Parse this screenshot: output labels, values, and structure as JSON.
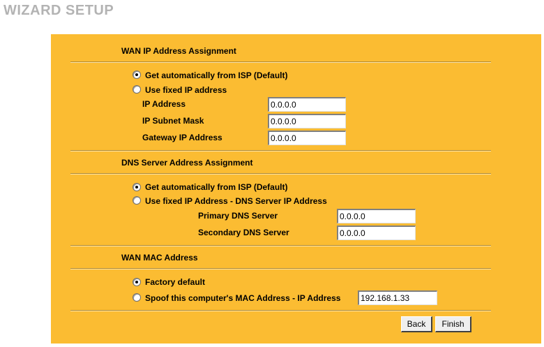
{
  "page_title": "WIZARD SETUP",
  "wan_ip": {
    "title": "WAN IP Address Assignment",
    "option_auto": "Get automatically from ISP (Default)",
    "option_fixed": "Use fixed IP address",
    "selected": "auto",
    "ip_address_label": "IP Address",
    "ip_address_value": "0.0.0.0",
    "subnet_mask_label": "IP Subnet Mask",
    "subnet_mask_value": "0.0.0.0",
    "gateway_label": "Gateway IP Address",
    "gateway_value": "0.0.0.0"
  },
  "dns": {
    "title": "DNS Server Address Assignment",
    "option_auto": "Get automatically from ISP (Default)",
    "option_fixed": "Use fixed IP Address - DNS Server IP Address",
    "selected": "auto",
    "primary_label": "Primary DNS Server",
    "primary_value": "0.0.0.0",
    "secondary_label": "Secondary DNS Server",
    "secondary_value": "0.0.0.0"
  },
  "wan_mac": {
    "title": "WAN MAC Address",
    "option_factory": "Factory default",
    "option_spoof": "Spoof this computer's MAC Address - IP Address",
    "selected": "factory",
    "spoof_ip_value": "192.168.1.33"
  },
  "buttons": {
    "back": "Back",
    "finish": "Finish"
  },
  "colors": {
    "panel_background": "#fbbc32",
    "title_color": "#b3b3b3"
  }
}
